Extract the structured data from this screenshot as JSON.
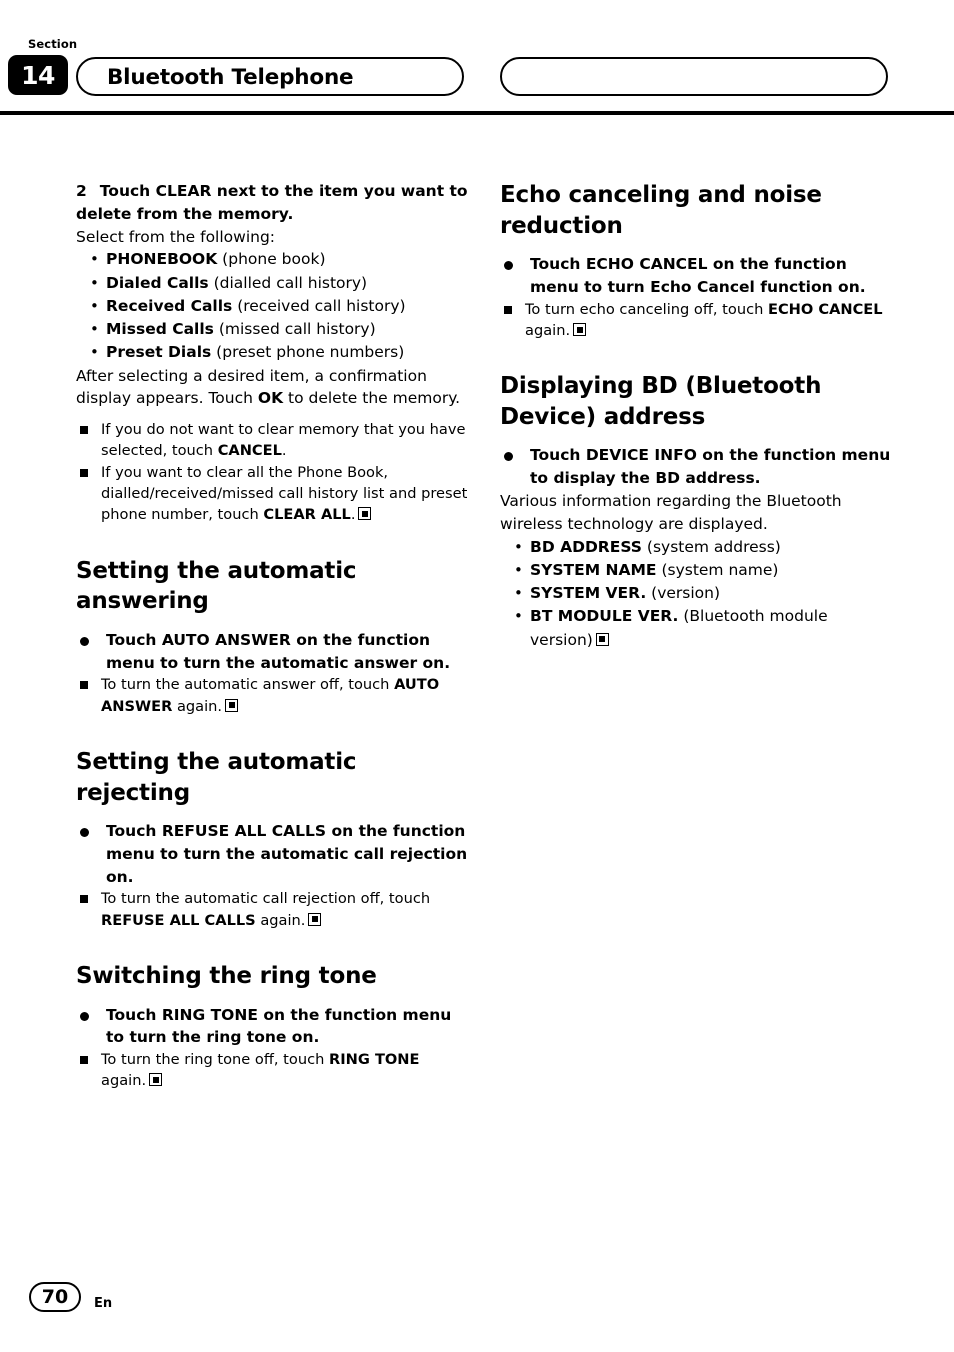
{
  "header": {
    "section_label": "Section",
    "section_number": "14",
    "title": "Bluetooth Telephone"
  },
  "footer": {
    "page_number": "70",
    "language": "En"
  },
  "left_column": {
    "step2": {
      "number": "2",
      "text": "Touch CLEAR next to the item you want to delete from the memory."
    },
    "select_from": "Select from the following:",
    "items": [
      {
        "term": "PHONEBOOK",
        "desc": " (phone book)"
      },
      {
        "term": "Dialed Calls",
        "desc": " (dialled call history)"
      },
      {
        "term": "Received Calls",
        "desc": " (received call history)"
      },
      {
        "term": "Missed Calls",
        "desc": " (missed call history)"
      },
      {
        "term": "Preset Dials",
        "desc": " (preset phone numbers)"
      }
    ],
    "after_select_1": "After selecting a desired item, a confirmation display appears. Touch ",
    "after_select_ok": "OK",
    "after_select_2": " to delete the memory.",
    "note1_1": "If you do not want to clear memory that you have selected, touch ",
    "note1_b": "CANCEL",
    "note1_2": ".",
    "note2_1": "If you want to clear all the Phone Book, dialled/received/missed call history list and preset phone number, touch ",
    "note2_b": "CLEAR ALL",
    "note2_2": ".",
    "h_auto_answering": "Setting the automatic answering",
    "auto_answering_bullet": "Touch AUTO ANSWER on the function menu to turn the automatic answer on.",
    "auto_answering_note_1": "To turn the automatic answer off, touch ",
    "auto_answering_note_b": "AUTO ANSWER",
    "auto_answering_note_2": " again.",
    "h_auto_rejecting": "Setting the automatic rejecting",
    "auto_rejecting_bullet": "Touch REFUSE ALL CALLS on the function menu to turn the automatic call rejection on.",
    "auto_rejecting_note_1": "To turn the automatic call rejection off, touch ",
    "auto_rejecting_note_b": "REFUSE ALL CALLS",
    "auto_rejecting_note_2": " again.",
    "h_ring_tone": "Switching the ring tone",
    "ring_tone_bullet": "Touch RING TONE on the function menu to turn the ring tone on.",
    "ring_tone_note_1": "To turn the ring tone off, touch ",
    "ring_tone_note_b": "RING TONE",
    "ring_tone_note_2": " again."
  },
  "right_column": {
    "h_echo": "Echo canceling and noise reduction",
    "echo_bullet": "Touch ECHO CANCEL on the function menu to turn Echo Cancel function on.",
    "echo_note_1": "To turn echo canceling off, touch ",
    "echo_note_b": "ECHO CANCEL",
    "echo_note_2": " again.",
    "h_bd": "Displaying BD (Bluetooth Device) address",
    "bd_bullet": "Touch DEVICE INFO on the function menu to display the BD address.",
    "bd_text": "Various information regarding the Bluetooth wireless technology are displayed.",
    "bd_items": [
      {
        "term": "BD ADDRESS",
        "desc": " (system address)"
      },
      {
        "term": "SYSTEM NAME",
        "desc": " (system name)"
      },
      {
        "term": "SYSTEM VER.",
        "desc": " (version)"
      },
      {
        "term": "BT MODULE VER.",
        "desc": " (Bluetooth module version)"
      }
    ]
  }
}
